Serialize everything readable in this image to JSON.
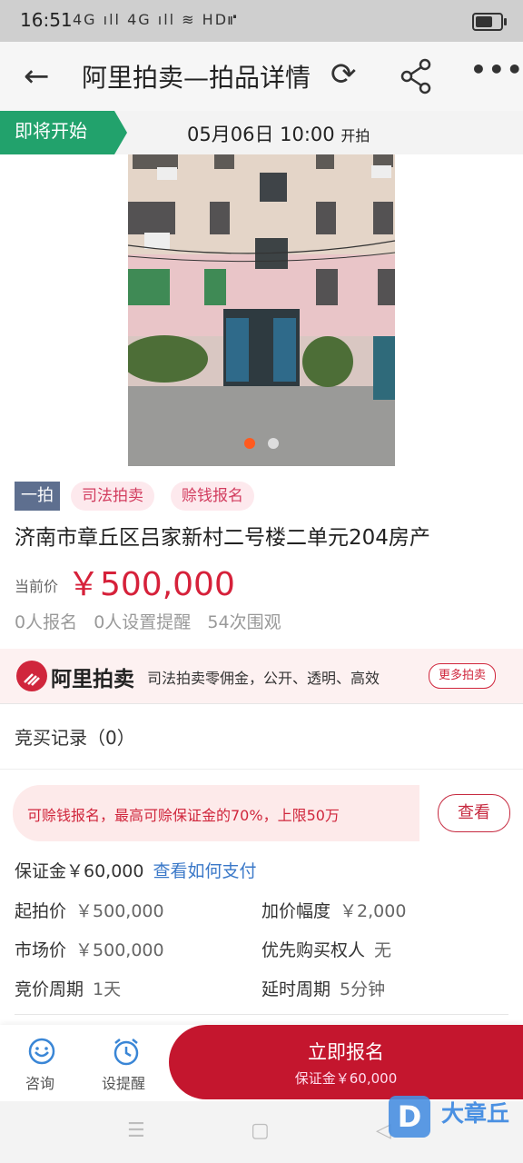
{
  "status_bar": {
    "time": "16:51",
    "signal": "4G ıll 4G ıll ≋ HD⑈"
  },
  "header": {
    "title": "阿里拍卖—拍品详情"
  },
  "banner": {
    "status": "即将开始",
    "date": "05月06日 10:00",
    "suffix": "开拍"
  },
  "item": {
    "round_tag": "一拍",
    "tags": [
      "司法拍卖",
      "赊钱报名"
    ],
    "title": "济南市章丘区吕家新村二号楼二单元204房产",
    "price_label": "当前价",
    "price": "￥500,000",
    "stats": "0人报名   0人设置提醒   54次围观"
  },
  "ad": {
    "brand": "阿里拍卖",
    "slogan": "司法拍卖零佣金，公开、透明、高效",
    "more_label": "更多拍卖"
  },
  "records": {
    "label": "竞买记录（0）"
  },
  "notice": {
    "text": "可赊钱报名，最高可赊保证金的70%，上限50万",
    "button": "查看"
  },
  "deposit": {
    "label": "保证金￥60,000",
    "link": "查看如何支付"
  },
  "details": [
    {
      "label": "起拍价",
      "value": "￥500,000"
    },
    {
      "label": "加价幅度",
      "value": "￥2,000"
    },
    {
      "label": "市场价",
      "value": "￥500,000"
    },
    {
      "label": "优先购买权人",
      "value": "无"
    },
    {
      "label": "竞价周期",
      "value": "1天"
    },
    {
      "label": "延时周期",
      "value": "5分钟"
    }
  ],
  "bottom": {
    "consult": "咨询",
    "remind": "设提醒",
    "signup_main": "立即报名",
    "signup_sub": "保证金￥60,000"
  },
  "watermark": {
    "letter": "D",
    "text": "大章丘"
  },
  "colors": {
    "accent": "#c4162e",
    "green": "#22a26c",
    "link": "#3a78c8"
  }
}
